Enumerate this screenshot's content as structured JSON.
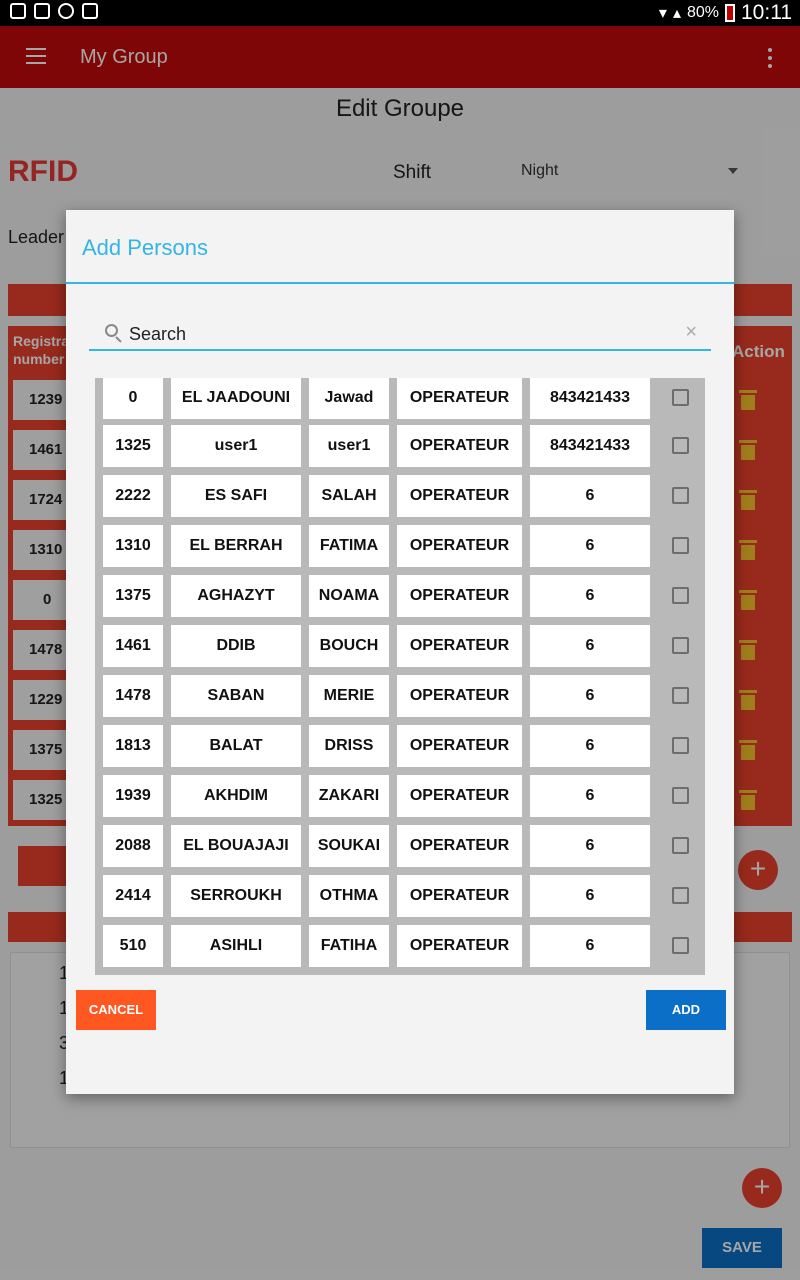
{
  "status_bar": {
    "battery": "80%",
    "time": "10:11"
  },
  "appbar": {
    "title": "My Group"
  },
  "screen": {
    "title": "Edit Groupe",
    "rfid_label": "RFID",
    "shift_label": "Shift",
    "shift_value": "Night",
    "leader_label": "Leader",
    "table_header_line1": "Registra",
    "table_header_line2": "number",
    "action_header": "Action",
    "reg_numbers": [
      "1239",
      "1461",
      "1724",
      "1310",
      "0",
      "1478",
      "1229",
      "1375",
      "1325"
    ],
    "lower_list": [
      "1",
      "1",
      "3",
      "1"
    ],
    "save_label": "SAVE",
    "fab_label": "+"
  },
  "dialog": {
    "title": "Add Persons",
    "search_placeholder": "Search",
    "clear_glyph": "×",
    "cancel_label": "CANCEL",
    "add_label": "ADD",
    "rows": [
      {
        "id": "0",
        "last": "EL JAADOUNI",
        "first": "Jawad",
        "role": "OPERATEUR",
        "num": "843421433"
      },
      {
        "id": "1325",
        "last": "user1",
        "first": "user1",
        "role": "OPERATEUR",
        "num": "843421433"
      },
      {
        "id": "2222",
        "last": "ES SAFI",
        "first": "SALAH",
        "role": "OPERATEUR",
        "num": "6"
      },
      {
        "id": "1310",
        "last": "EL BERRAH",
        "first": "FATIMA",
        "role": "OPERATEUR",
        "num": "6"
      },
      {
        "id": "1375",
        "last": "AGHAZYT",
        "first": "NOAMA",
        "role": "OPERATEUR",
        "num": "6"
      },
      {
        "id": "1461",
        "last": "DDIB",
        "first": "BOUCH",
        "role": "OPERATEUR",
        "num": "6"
      },
      {
        "id": "1478",
        "last": "SABAN",
        "first": "MERIE",
        "role": "OPERATEUR",
        "num": "6"
      },
      {
        "id": "1813",
        "last": "BALAT",
        "first": "DRISS",
        "role": "OPERATEUR",
        "num": "6"
      },
      {
        "id": "1939",
        "last": "AKHDIM",
        "first": "ZAKARI",
        "role": "OPERATEUR",
        "num": "6"
      },
      {
        "id": "2088",
        "last": "EL BOUAJAJI",
        "first": "SOUKAI",
        "role": "OPERATEUR",
        "num": "6"
      },
      {
        "id": "2414",
        "last": "SERROUKH",
        "first": "OTHMA",
        "role": "OPERATEUR",
        "num": "6"
      },
      {
        "id": "510",
        "last": "ASIHLI",
        "first": "FATIHA",
        "role": "OPERATEUR",
        "num": "6"
      }
    ]
  }
}
